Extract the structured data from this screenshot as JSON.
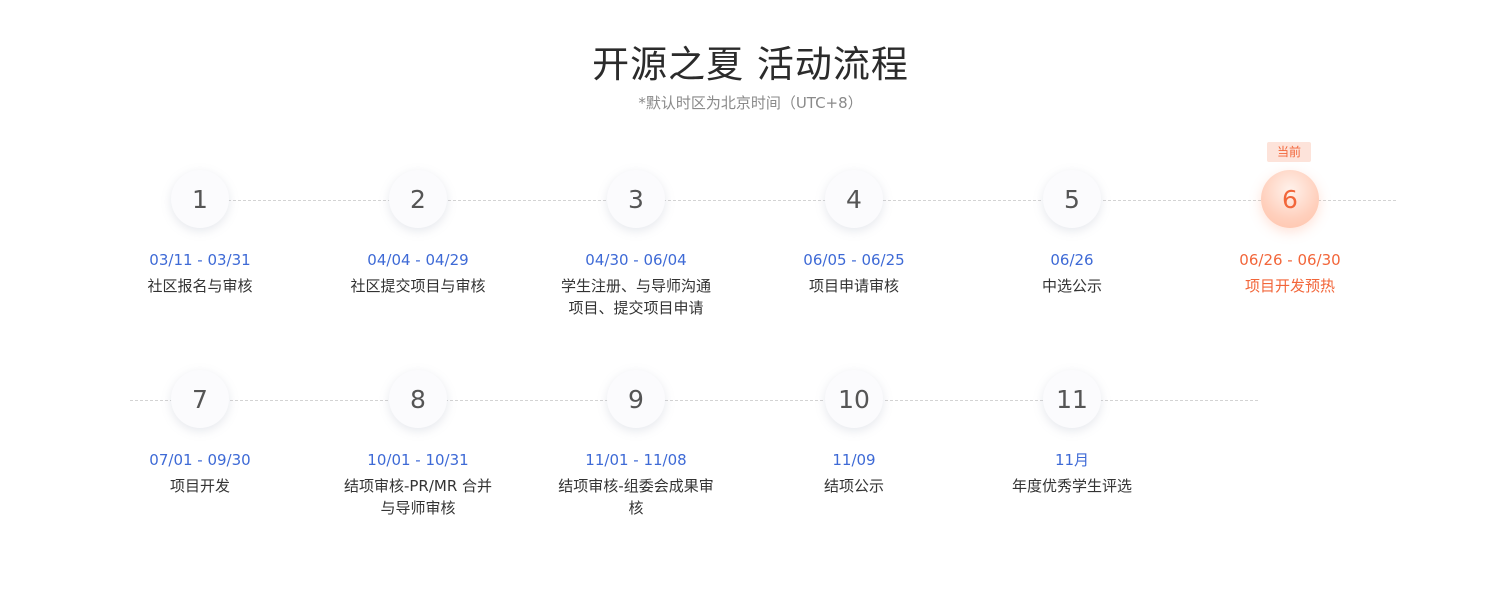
{
  "header": {
    "title": "开源之夏 活动流程",
    "subtitle": "*默认时区为北京时间（UTC+8）"
  },
  "current_badge": "当前",
  "steps": [
    {
      "num": "1",
      "date": "03/11 - 03/31",
      "label": "社区报名与审核"
    },
    {
      "num": "2",
      "date": "04/04 - 04/29",
      "label": "社区提交项目与审核"
    },
    {
      "num": "3",
      "date": "04/30 - 06/04",
      "label": "学生注册、与导师沟通项目、提交项目申请"
    },
    {
      "num": "4",
      "date": "06/05 - 06/25",
      "label": "项目申请审核"
    },
    {
      "num": "5",
      "date": "06/26",
      "label": "中选公示"
    },
    {
      "num": "6",
      "date": "06/26 - 06/30",
      "label": "项目开发预热"
    },
    {
      "num": "7",
      "date": "07/01 - 09/30",
      "label": "项目开发"
    },
    {
      "num": "8",
      "date": "10/01 - 10/31",
      "label": "结项审核-PR/MR 合并与导师审核"
    },
    {
      "num": "9",
      "date": "11/01 - 11/08",
      "label": "结项审核-组委会成果审核"
    },
    {
      "num": "10",
      "date": "11/09",
      "label": "结项公示"
    },
    {
      "num": "11",
      "date": "11月",
      "label": "年度优秀学生评选"
    }
  ],
  "colors": {
    "date_blue": "#3e6ad6",
    "current_orange": "#f2663a",
    "badge_bg": "#fde3da",
    "text_dark": "#333333"
  }
}
